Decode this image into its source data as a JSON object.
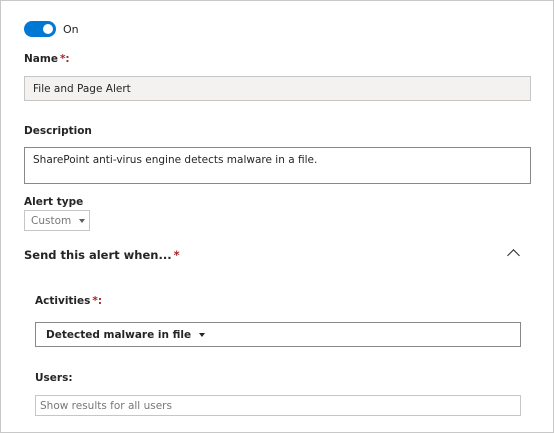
{
  "toggle": {
    "state_label": "On"
  },
  "name_field": {
    "label": "Name",
    "required_mark": "*:",
    "value": "File and Page Alert"
  },
  "description_field": {
    "label": "Description",
    "value": "SharePoint anti-virus engine detects malware in a file."
  },
  "alert_type": {
    "label": "Alert type",
    "selected": "Custom"
  },
  "section": {
    "title": "Send this alert when...",
    "required_mark": "*"
  },
  "activities": {
    "label": "Activities",
    "required_mark": "*:",
    "selected": "Detected malware in file"
  },
  "users": {
    "label": "Users:",
    "placeholder": "Show results for all users"
  },
  "colors": {
    "accent": "#0078d4",
    "required": "#a4262c"
  }
}
